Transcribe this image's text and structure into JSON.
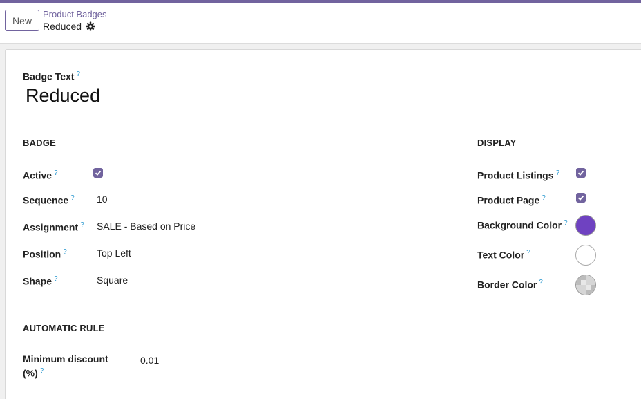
{
  "header": {
    "new_label": "New",
    "breadcrumb_parent": "Product Badges",
    "breadcrumb_current": "Reduced"
  },
  "form": {
    "badge_text_label": "Badge Text",
    "badge_text_value": "Reduced",
    "help_mark": "?",
    "badge_section": {
      "title": "BADGE",
      "active_label": "Active",
      "active_checked": true,
      "sequence_label": "Sequence",
      "sequence_value": "10",
      "assignment_label": "Assignment",
      "assignment_value": "SALE - Based on Price",
      "position_label": "Position",
      "position_value": "Top Left",
      "shape_label": "Shape",
      "shape_value": "Square"
    },
    "display_section": {
      "title": "DISPLAY",
      "product_listings_label": "Product Listings",
      "product_listings_checked": true,
      "product_page_label": "Product Page",
      "product_page_checked": true,
      "background_color_label": "Background Color",
      "background_color": "#6f42c1",
      "text_color_label": "Text Color",
      "text_color": "#ffffff",
      "border_color_label": "Border Color",
      "border_color": "transparent"
    },
    "automatic_rule_section": {
      "title": "AUTOMATIC RULE",
      "min_discount_label_line1": "Minimum discount",
      "min_discount_label_line2": "(%)",
      "min_discount_value": "0.01"
    }
  },
  "colors": {
    "brand": "#71639e",
    "help": "#2e9ad0"
  }
}
